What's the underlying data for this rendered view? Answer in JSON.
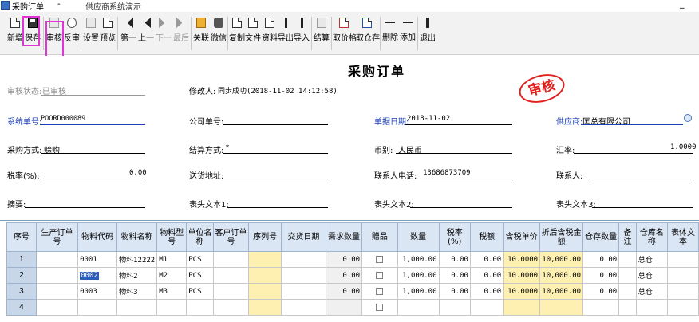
{
  "titlebar": {
    "app_title": "采购订单",
    "dash": "-",
    "subtitle": "供应商系统演示",
    "minimize": "_"
  },
  "toolbar": {
    "buttons": [
      {
        "label": "新增",
        "icon": "new-doc-icon"
      },
      {
        "label": "保存",
        "icon": "save-icon"
      },
      {
        "label": "审核",
        "icon": "audit-icon"
      },
      {
        "label": "反审",
        "icon": "unaudit-icon"
      },
      {
        "label": "设置",
        "icon": "print-icon"
      },
      {
        "label": "预览",
        "icon": "preview-icon"
      },
      {
        "label": "第一",
        "icon": "first-icon"
      },
      {
        "label": "上一",
        "icon": "prev-icon"
      },
      {
        "label": "下一",
        "icon": "next-icon"
      },
      {
        "label": "最后",
        "icon": "last-icon"
      },
      {
        "label": "关联",
        "icon": "link-icon"
      },
      {
        "label": "微信",
        "icon": "wechat-icon"
      },
      {
        "label": "复制",
        "icon": "copy-icon"
      },
      {
        "label": "文件",
        "icon": "file-icon"
      },
      {
        "label": "资料",
        "icon": "data-icon"
      },
      {
        "label": "导出",
        "icon": "export-icon"
      },
      {
        "label": "导入",
        "icon": "import-icon"
      },
      {
        "label": "结算",
        "icon": "calc-icon"
      },
      {
        "label": "取价格",
        "icon": "price-icon"
      },
      {
        "label": "取仓存",
        "icon": "stock-icon"
      },
      {
        "label": "删除",
        "icon": "delete-row-icon"
      },
      {
        "label": "添加",
        "icon": "add-row-icon"
      },
      {
        "label": "退出",
        "icon": "exit-icon"
      }
    ]
  },
  "form": {
    "title": "采购订单",
    "stamp": "审核",
    "audit_status_label": "审核状态:",
    "audit_status_value": "已审核",
    "modifier_label": "修改人:",
    "modifier_value": "同步成功(2018-11-02 14:12:58)",
    "sys_no_label": "系统单号:",
    "sys_no_value": "POORD000089",
    "company_no_label": "公司单号:",
    "company_no_value": "",
    "doc_date_label": "单据日期:",
    "doc_date_value": "2018-11-02",
    "supplier_label": "供应商:",
    "supplier_value": "匡总有限公司",
    "purchase_mode_label": "采购方式:",
    "purchase_mode_value": "赊购",
    "settle_mode_label": "结算方式:",
    "settle_mode_value": "*",
    "currency_label": "币别:",
    "currency_value": "人民币",
    "rate_label": "汇率:",
    "rate_value": "1.0000",
    "tax_rate_label": "税率(%):",
    "tax_rate_value": "0.00",
    "address_label": "送货地址:",
    "address_value": "",
    "phone_label": "联系人电话:",
    "phone_value": "13686873709",
    "contact_label": "联系人:",
    "contact_value": "",
    "remark_label": "摘要:",
    "remark_value": "",
    "text1_label": "表头文本1:",
    "text2_label": "表头文本2:",
    "text3_label": "表头文本3:"
  },
  "grid": {
    "columns": [
      "序号",
      "生产订单号",
      "物料代码",
      "物料名称",
      "物料型号",
      "单位名称",
      "客户订单号",
      "序列号",
      "交货日期",
      "需求数量",
      "赠品",
      "数量",
      "税率(%)",
      "税额",
      "含税单价",
      "折后含税金额",
      "仓存数量",
      "备注",
      "仓库名称",
      "表体文本"
    ],
    "rows": [
      {
        "no": "1",
        "code": "0001",
        "name": "物料12222",
        "model": "M1",
        "unit": "PCS",
        "demand": "0.00",
        "qty": "1,000.00",
        "tax_rate": "0.00",
        "tax": "0.00",
        "price": "10.0000",
        "amount": "10,000.00",
        "stock": "0.00",
        "warehouse": "总仓"
      },
      {
        "no": "2",
        "code": "0002",
        "name": "物料2",
        "model": "M2",
        "unit": "PCS",
        "demand": "0.00",
        "qty": "1,000.00",
        "tax_rate": "0.00",
        "tax": "0.00",
        "price": "10.0000",
        "amount": "10,000.00",
        "stock": "0.00",
        "warehouse": "总仓"
      },
      {
        "no": "3",
        "code": "0003",
        "name": "物料3",
        "model": "M3",
        "unit": "PCS",
        "demand": "0.00",
        "qty": "1,000.00",
        "tax_rate": "0.00",
        "tax": "0.00",
        "price": "10.0000",
        "amount": "10,000.00",
        "stock": "0.00",
        "warehouse": "总仓"
      },
      {
        "no": "4",
        "code": "",
        "name": "",
        "model": "",
        "unit": "",
        "demand": "",
        "qty": "",
        "tax_rate": "",
        "tax": "",
        "price": "",
        "amount": "",
        "stock": "",
        "warehouse": ""
      }
    ]
  },
  "colors": {
    "highlight": "#e033d8",
    "stamp": "#e0201c",
    "link_blue": "#1c3fb7",
    "header_bg": "#dbe6f4",
    "yellow_cell": "#fdf0b0"
  }
}
